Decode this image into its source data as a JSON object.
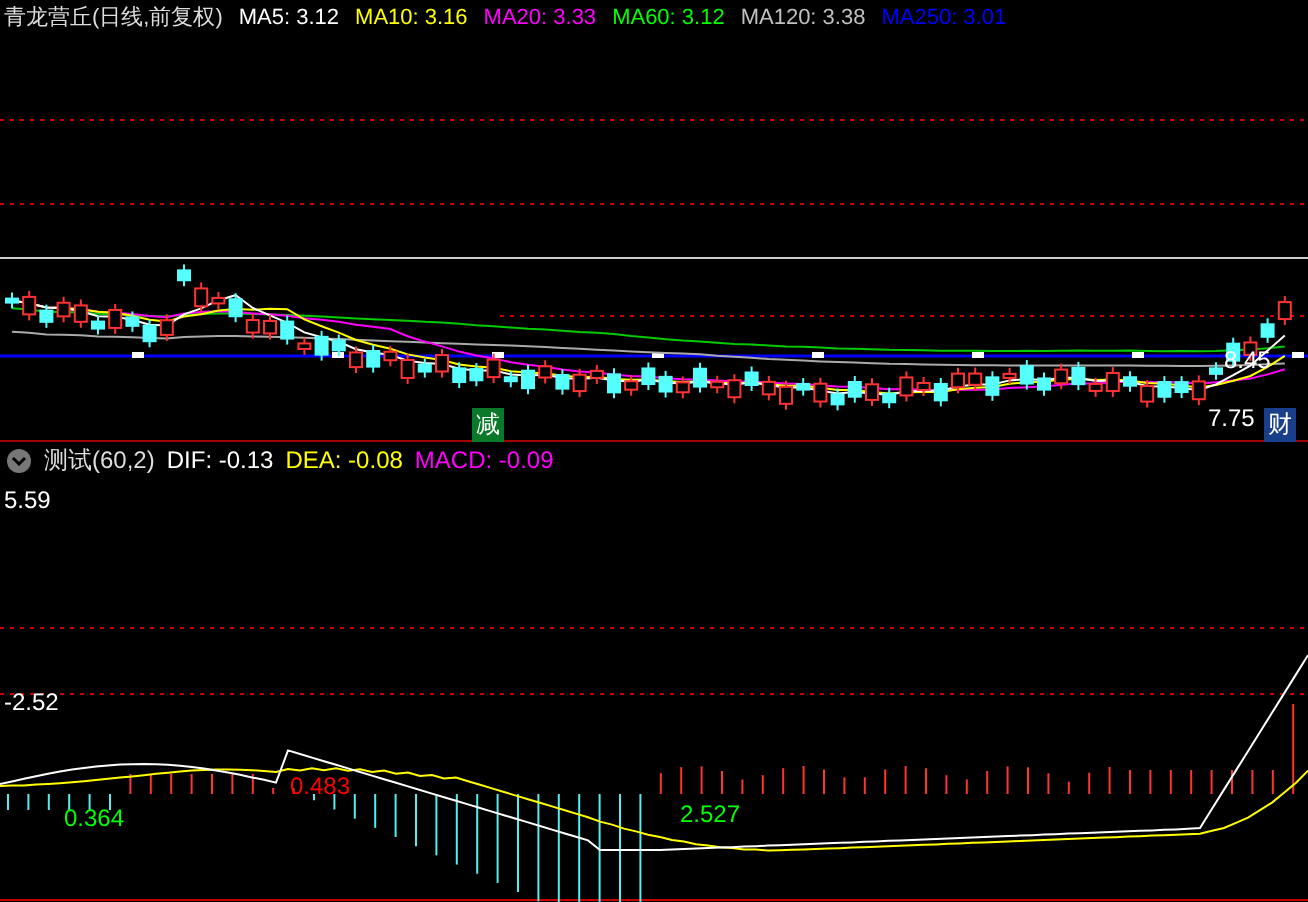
{
  "main_chart": {
    "title": "青龙营丘(日线,前复权)",
    "indicators": [
      {
        "label": "MA5: 3.12",
        "color": "#ffffff"
      },
      {
        "label": "MA10: 3.16",
        "color": "#ffff00"
      },
      {
        "label": "MA20: 3.33",
        "color": "#ff00ff"
      },
      {
        "label": "MA60: 3.12",
        "color": "#00ff00"
      },
      {
        "label": "MA120: 3.38",
        "color": "#c0c0c0"
      },
      {
        "label": "MA250: 3.01",
        "color": "#0000ff"
      }
    ],
    "price_labels": [
      "8.45",
      "7.75"
    ],
    "markers": [
      {
        "label": "减",
        "kind": "reduce"
      },
      {
        "label": "财",
        "kind": "finance"
      }
    ]
  },
  "indicator_chart": {
    "name": "测试(60,2)",
    "values": [
      {
        "label": "DIF: -0.13",
        "color": "#ffffff"
      },
      {
        "label": "DEA: -0.08",
        "color": "#ffff00"
      },
      {
        "label": "MACD: -0.09",
        "color": "#ff00ff"
      }
    ],
    "axis_labels": [
      "5.59",
      "-2.52"
    ],
    "annotations": [
      {
        "label": "0.364",
        "color": "#00ff00"
      },
      {
        "label": "0.483",
        "color": "#ff0000"
      },
      {
        "label": "2.527",
        "color": "#00ff00"
      }
    ]
  }
}
